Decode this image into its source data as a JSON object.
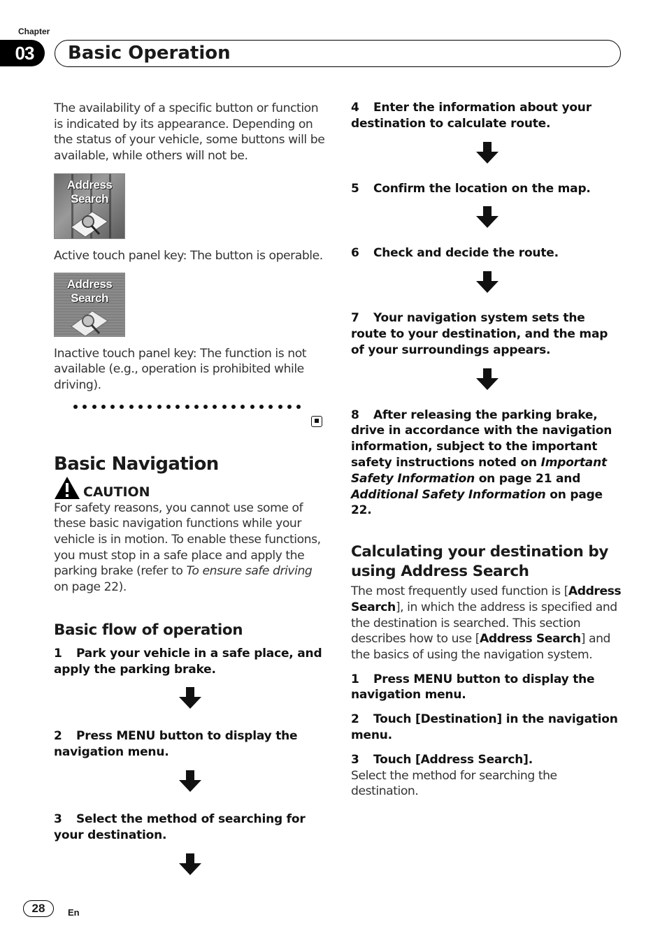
{
  "header": {
    "chapter_label": "Chapter",
    "chapter_number": "03",
    "chapter_title": "Basic Operation"
  },
  "left": {
    "intro": "The availability of a specific button or function is indicated by its appearance. Depending on the status of your vehicle, some buttons will be available, while others will not be.",
    "active_key": {
      "button_label_line1": "Address",
      "button_label_line2": "Search",
      "caption": "Active touch panel key: The button is operable."
    },
    "inactive_key": {
      "button_label_line1": "Address",
      "button_label_line2": "Search",
      "caption": "Inactive touch panel key: The function is not available (e.g., operation is prohibited while driving)."
    },
    "section_title": "Basic Navigation",
    "caution": {
      "label": "CAUTION",
      "text_part1": "For safety reasons, you cannot use some of these basic navigation functions while your vehicle is in motion. To enable these functions, you must stop in a safe place and apply the parking brake (refer to ",
      "text_italic": "To ensure safe driving",
      "text_part2": " on page 22)."
    },
    "subsection_title": "Basic flow of operation",
    "steps": [
      {
        "num": "1",
        "text": "Park your vehicle in a safe place, and apply the parking brake."
      },
      {
        "num": "2",
        "text": "Press MENU button to display the navigation menu."
      },
      {
        "num": "3",
        "text": "Select the method of searching for your destination."
      }
    ]
  },
  "right": {
    "steps": [
      {
        "num": "4",
        "text": "Enter the information about your destination to calculate route."
      },
      {
        "num": "5",
        "text": "Confirm the location on the map."
      },
      {
        "num": "6",
        "text": "Check and decide the route."
      },
      {
        "num": "7",
        "text": "Your navigation system sets the route to your destination, and the map of your surroundings appears."
      }
    ],
    "step8": {
      "num": "8",
      "text_part1": "After releasing the parking brake, drive in accordance with the navigation information, subject to the important safety instructions noted on ",
      "italic1": "Important Safety Information",
      "text_part2": " on page 21 and ",
      "italic2": "Additional Safety Information",
      "text_part3": " on page 22."
    },
    "section_title": "Calculating your destination by using Address Search",
    "desc": {
      "part1": "The most frequently used function is [",
      "bold1": "Address Search",
      "part2": "], in which the address is specified and the destination is searched. This section describes how to use [",
      "bold2": "Address Search",
      "part3": "] and the basics of using the navigation system."
    },
    "steps2": [
      {
        "num": "1",
        "text": "Press MENU button to display the navigation menu."
      },
      {
        "num": "2",
        "text": "Touch [Destination] in the navigation menu."
      },
      {
        "num": "3",
        "text": "Touch [Address Search]."
      }
    ],
    "step3_note": "Select the method for searching the destination."
  },
  "footer": {
    "page_number": "28",
    "language": "En"
  },
  "icons": {
    "flow_arrow": "down-arrow-icon",
    "caution": "warning-triangle-icon",
    "end_of_section": "end-mark-icon"
  }
}
